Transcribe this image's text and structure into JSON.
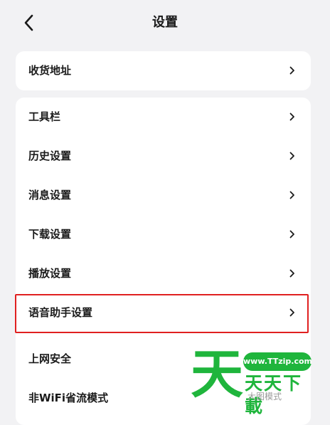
{
  "header": {
    "title": "设置",
    "back_icon": "chevron-left-icon"
  },
  "address_card": {
    "items": [
      {
        "label": "收货地址"
      }
    ]
  },
  "settings_card": {
    "items": [
      {
        "label": "工具栏"
      },
      {
        "label": "历史设置"
      },
      {
        "label": "消息设置"
      },
      {
        "label": "下载设置"
      },
      {
        "label": "播放设置"
      },
      {
        "label": "语音助手设置",
        "highlighted": true
      },
      {
        "label": "上网安全"
      },
      {
        "label": "非WiFi省流模式"
      }
    ]
  },
  "watermark": {
    "char": "天",
    "url": "www.TTzip.com",
    "name": "天天下載",
    "partial_text": "大图模式"
  },
  "colors": {
    "highlight_border": "#e02020",
    "watermark_green": "#1fb53c",
    "background": "#f2f2f4"
  }
}
